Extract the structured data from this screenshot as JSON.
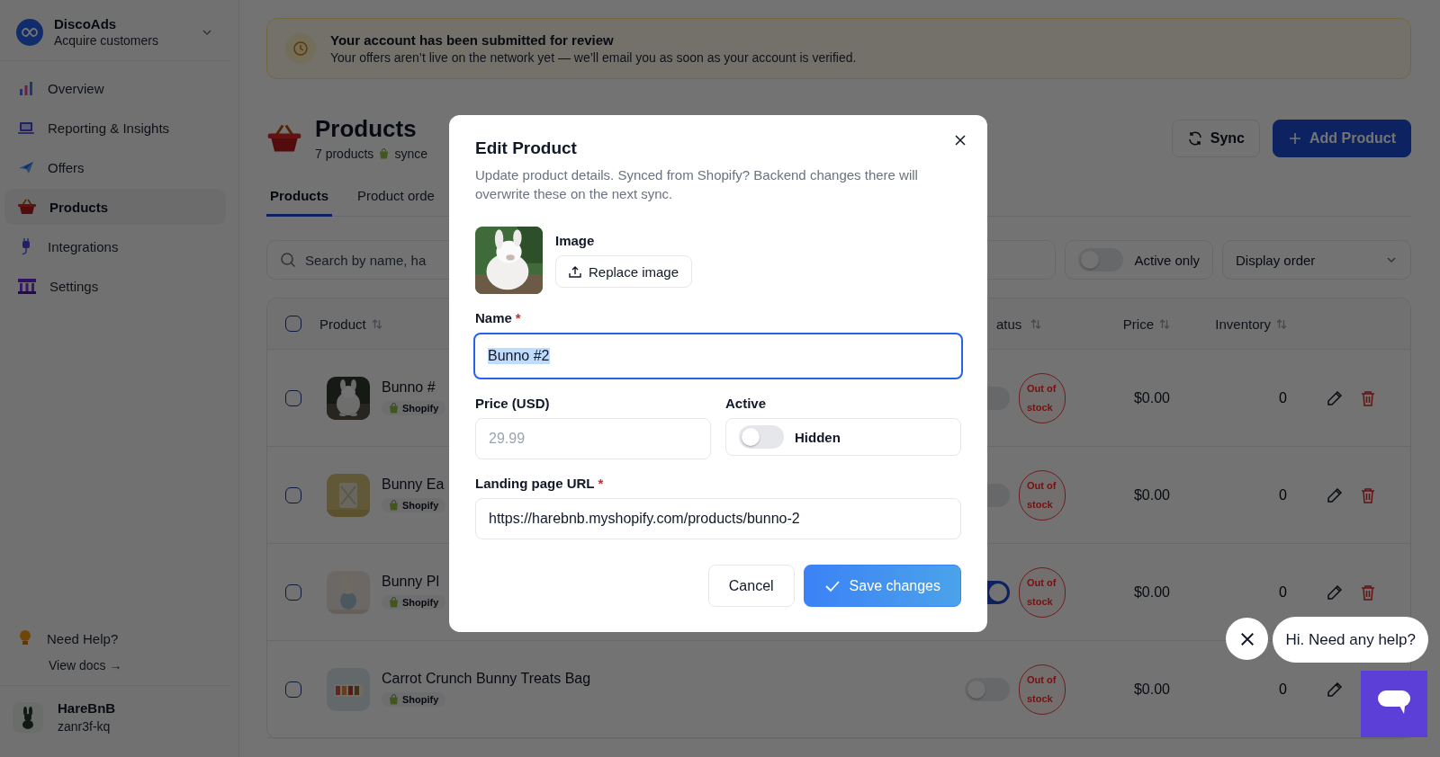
{
  "sidebar": {
    "brand": {
      "name": "DiscoAds",
      "tagline": "Acquire customers"
    },
    "items": [
      {
        "label": "Overview",
        "selected": false
      },
      {
        "label": "Reporting & Insights",
        "selected": false
      },
      {
        "label": "Offers",
        "selected": false
      },
      {
        "label": "Products",
        "selected": true
      },
      {
        "label": "Integrations",
        "selected": false
      },
      {
        "label": "Settings",
        "selected": false
      }
    ],
    "help": {
      "title": "Need Help?",
      "link": "View docs →"
    },
    "account": {
      "name": "HareBnB",
      "handle": "zanr3f-kq"
    }
  },
  "banner": {
    "title": "Your account has been submitted for review",
    "message": "Your offers aren’t live on the network yet — we’ll email you as soon as your account is verified."
  },
  "page": {
    "title": "Products",
    "count": "7 products",
    "sync_status": "synce",
    "actions": [
      {
        "label": "Sync",
        "kind": "secondary"
      },
      {
        "label": "Add Product",
        "kind": "primary"
      }
    ]
  },
  "tabs": [
    {
      "label": "Products",
      "selected": true
    },
    {
      "label": "Product orde",
      "selected": false
    }
  ],
  "filters": {
    "search": {
      "placeholder": "Search by name, ha"
    },
    "active_only": {
      "label": "Active only",
      "on": false
    },
    "sort": {
      "value": "Display order"
    }
  },
  "table": {
    "all_checked": false,
    "columns": [
      "Product",
      "atus",
      "Price",
      "Inventory"
    ],
    "rows": [
      {
        "name": "Bunno #",
        "source": "Shopify",
        "checked": false,
        "active": false,
        "stock": "Out of stock",
        "price": "$0.00",
        "inventory": "0",
        "deletable": true
      },
      {
        "name": "Bunny Ea",
        "source": "Shopify",
        "checked": false,
        "active": false,
        "stock": "Out of stock",
        "price": "$0.00",
        "inventory": "0",
        "deletable": true
      },
      {
        "name": "Bunny Pl",
        "source": "Shopify",
        "checked": false,
        "active": true,
        "stock": "Out of stock",
        "price": "$0.00",
        "inventory": "0",
        "deletable": true
      },
      {
        "name": "Carrot Crunch Bunny Treats Bag",
        "source": "Shopify",
        "checked": false,
        "active": false,
        "stock": "Out of stock",
        "price": "$0.00",
        "inventory": "0"
      }
    ]
  },
  "modal": {
    "title": "Edit Product",
    "description": "Update product details. Synced from Shopify? Backend changes there will overwrite these on the next sync.",
    "image": {
      "label": "Image",
      "button": "Replace image"
    },
    "name": {
      "label": "Name",
      "required_mark": "*",
      "value": "Bunno #2",
      "text_selected": true
    },
    "price": {
      "label": "Price (USD)",
      "placeholder": "29.99"
    },
    "active": {
      "label": "Active",
      "on": false,
      "state_label": "Hidden"
    },
    "url": {
      "label": "Landing page URL",
      "required_mark": "*",
      "value": "https://harebnb.myshopify.com/products/bunno-2"
    },
    "buttons": [
      {
        "label": "Cancel",
        "kind": "secondary"
      },
      {
        "label": "Save changes",
        "kind": "primary"
      }
    ]
  },
  "chat": {
    "message": "Hi. Need any help?"
  }
}
